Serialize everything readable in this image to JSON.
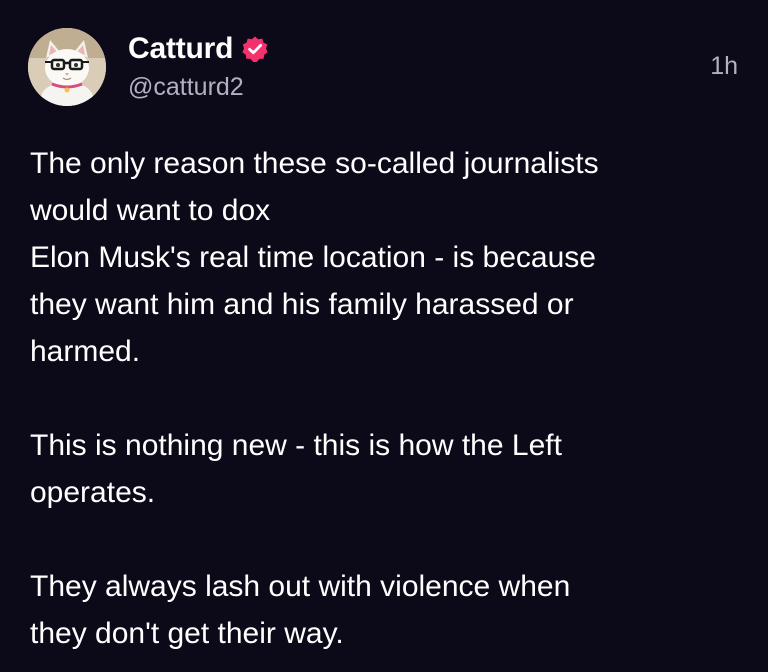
{
  "post": {
    "author": {
      "display_name": "Catturd",
      "handle": "@catturd2",
      "verified_icon": "verified-badge-icon",
      "avatar_icon": "cat-with-glasses-avatar"
    },
    "timestamp": "1h",
    "paragraphs": [
      {
        "lines": [
          "The only reason these so-called journalists",
          "would want to dox",
          "Elon Musk's real time location - is because",
          "they want him and his family harassed or",
          "harmed."
        ]
      },
      {
        "lines": [
          "This is nothing new - this is how the Left",
          "operates."
        ]
      },
      {
        "lines": [
          "They always lash out with violence when",
          "they don't get their way."
        ]
      }
    ]
  },
  "colors": {
    "background": "#0c0918",
    "text_primary": "#ffffff",
    "text_secondary": "#b4b0c2",
    "verified_badge": "#f4306d"
  }
}
